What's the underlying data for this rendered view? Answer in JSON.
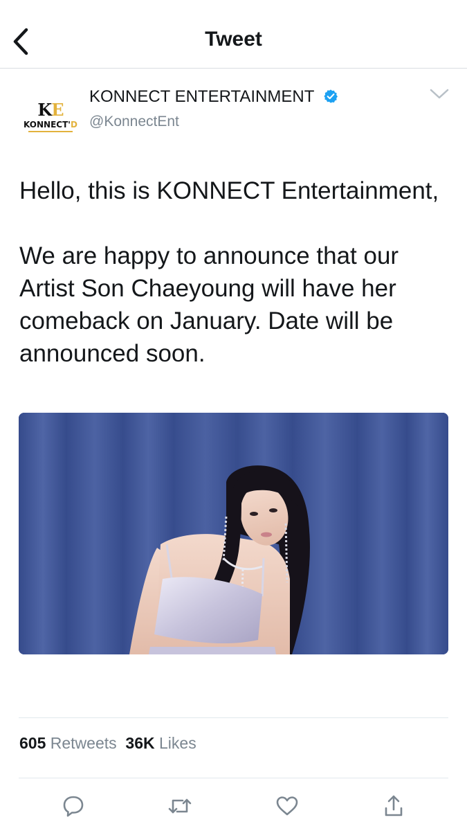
{
  "nav": {
    "title": "Tweet",
    "back_icon": "chevron-left-icon"
  },
  "author": {
    "name": "KONNECT ENTERTAINMENT",
    "handle": "@KonnectEnt",
    "verified": true,
    "avatar_logo": {
      "mark_k": "K",
      "mark_e": "E",
      "wordmark_main": "KONNECT'",
      "wordmark_accent": "D"
    },
    "menu_icon": "chevron-down-icon"
  },
  "tweet": {
    "text": "Hello, this is KONNECT Entertainment,\n\nWe are happy to announce that our Artist Son Chaeyoung will have her comeback on January. Date will be announced soon.",
    "has_media": true
  },
  "stats": {
    "retweets_count": "605",
    "retweets_label": "Retweets",
    "likes_count": "36K",
    "likes_label": "Likes"
  },
  "actions": [
    "reply-icon",
    "retweet-icon",
    "like-icon",
    "share-icon"
  ],
  "colors": {
    "text": "#14171a",
    "secondary": "#7b8690",
    "verified": "#1da1f2",
    "divider": "#e1e8ed",
    "brand_gold": "#e3b23c"
  }
}
